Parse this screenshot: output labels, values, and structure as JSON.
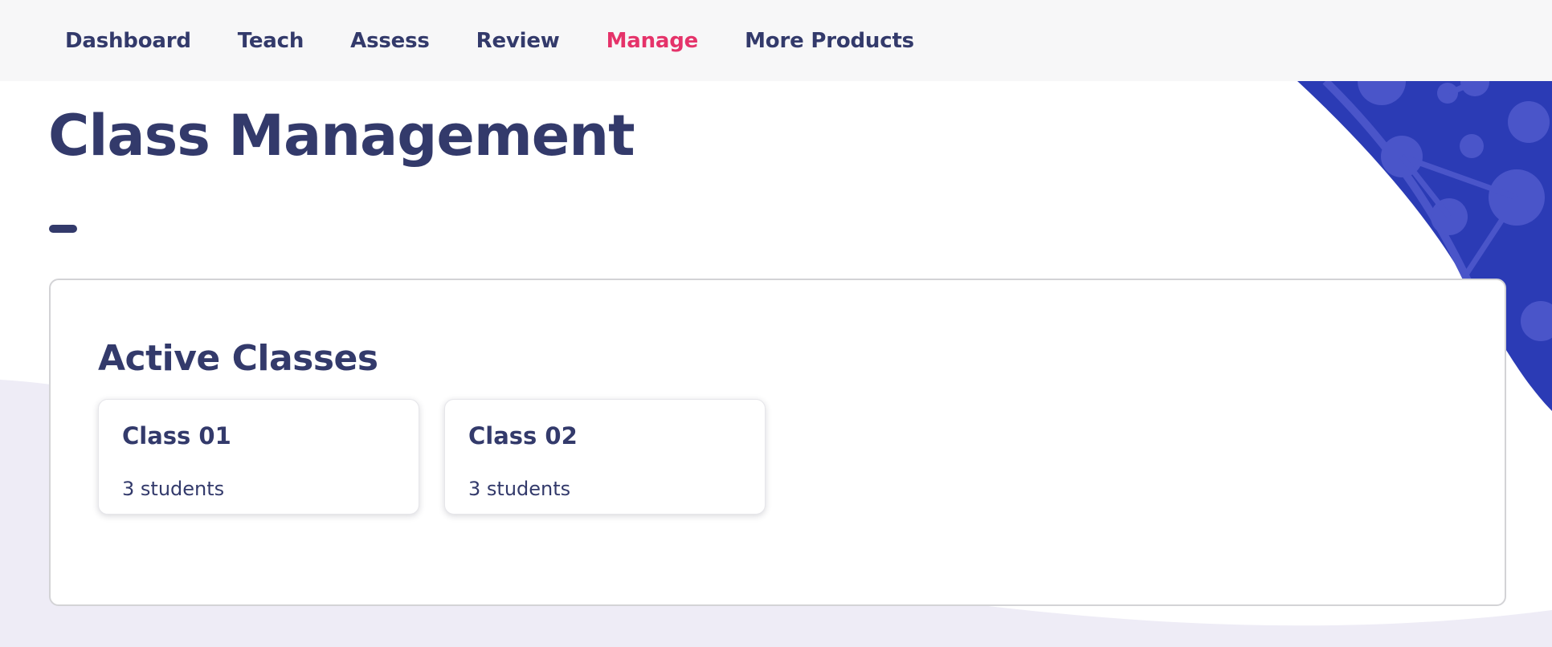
{
  "nav": {
    "items": [
      {
        "label": "Dashboard",
        "active": false
      },
      {
        "label": "Teach",
        "active": false
      },
      {
        "label": "Assess",
        "active": false
      },
      {
        "label": "Review",
        "active": false
      },
      {
        "label": "Manage",
        "active": true
      },
      {
        "label": "More Products",
        "active": false
      }
    ]
  },
  "page": {
    "title": "Class Management"
  },
  "active_classes": {
    "title": "Active Classes",
    "classes": [
      {
        "name": "Class 01",
        "students": "3 students"
      },
      {
        "name": "Class 02",
        "students": "3 students"
      }
    ]
  },
  "colors": {
    "primary_text": "#333a6b",
    "active_nav": "#e5336a",
    "decor_blue": "#2b3bb5",
    "decor_lavender": "#eeecf6"
  }
}
